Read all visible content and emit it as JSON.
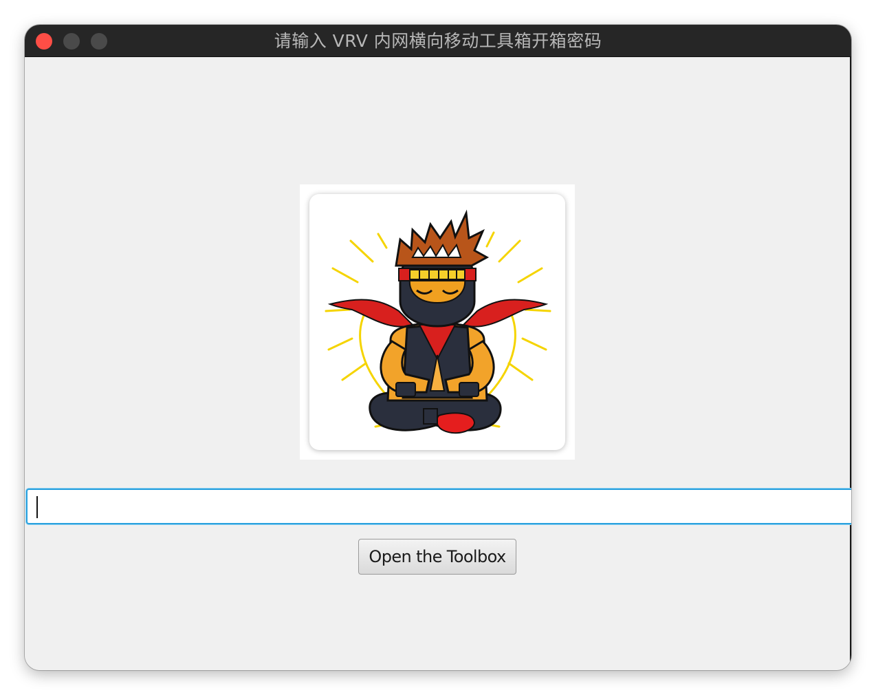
{
  "window": {
    "title": "请输入 VRV 内网横向移动工具箱开箱密码"
  },
  "controls": [
    "close",
    "minimize",
    "zoom"
  ],
  "logo": {
    "icon": "meditating-ninja-image"
  },
  "password_field": {
    "value": "",
    "placeholder": ""
  },
  "open_button": {
    "label": "Open the Toolbox"
  },
  "colors": {
    "titlebar": "#262626",
    "content_bg": "#f0f0f0",
    "close_button": "#fe4e46",
    "focus_ring": "#2aa1de"
  }
}
